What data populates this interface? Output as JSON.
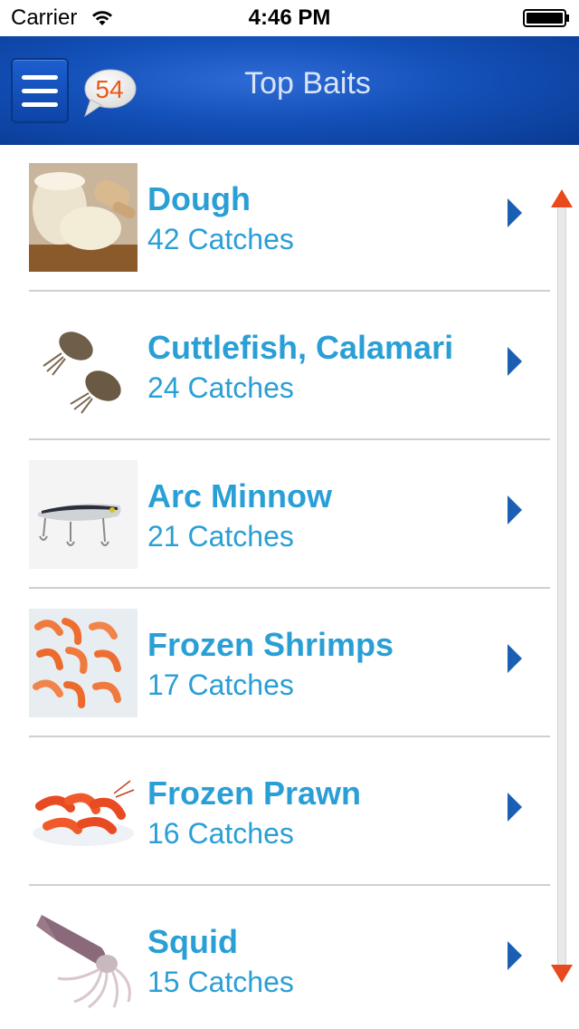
{
  "status_bar": {
    "carrier": "Carrier",
    "time": "4:46 PM",
    "icons": [
      "wifi-icon",
      "battery-icon"
    ]
  },
  "nav": {
    "title": "Top Baits",
    "badge_count": "54",
    "menu_icon": "hamburger-menu-icon",
    "colors": {
      "bar": "#1350b8",
      "badge_text": "#e85a1c",
      "title": "#d8e4f7"
    }
  },
  "baits": [
    {
      "name": "Dough",
      "catches": "42 Catches",
      "image": "dough-image"
    },
    {
      "name": "Cuttlefish, Calamari",
      "catches": "24 Catches",
      "image": "cuttlefish-image"
    },
    {
      "name": "Arc Minnow",
      "catches": "21 Catches",
      "image": "minnow-lure-image"
    },
    {
      "name": "Frozen Shrimps",
      "catches": "17 Catches",
      "image": "shrimps-image"
    },
    {
      "name": "Frozen Prawn",
      "catches": "16 Catches",
      "image": "prawn-image"
    },
    {
      "name": "Squid",
      "catches": "15 Catches",
      "image": "squid-image"
    }
  ],
  "colors": {
    "item_text": "#2a9fd6",
    "chevron": "#1a5fb4",
    "scroll_arrow": "#e8491d",
    "divider": "#cfcfcf"
  }
}
